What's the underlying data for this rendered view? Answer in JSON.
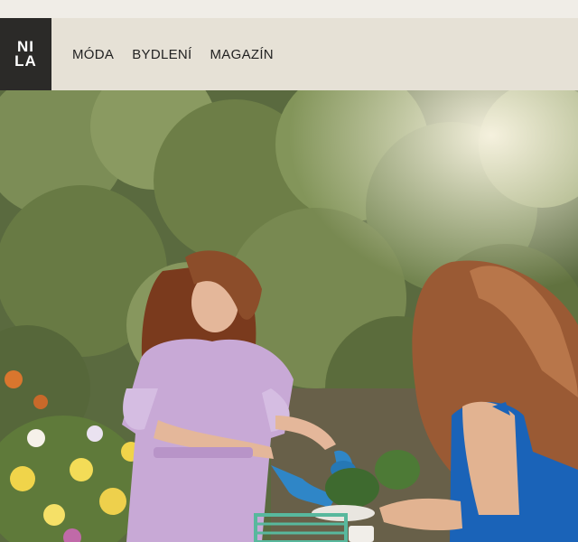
{
  "logo": {
    "line1": "NI",
    "line2": "LA"
  },
  "nav": {
    "items": [
      {
        "label": "MÓDA"
      },
      {
        "label": "BYDLENÍ"
      },
      {
        "label": "MAGAZÍN"
      }
    ]
  },
  "hero": {
    "image_subject": "two-women-gardening-photo",
    "colors": {
      "foliage": "#6d7f4a",
      "dress_lilac": "#c8a9d6",
      "top_blue": "#1a63b8",
      "hair": "#8c4d2a",
      "watering_can": "#2f86c7"
    }
  }
}
